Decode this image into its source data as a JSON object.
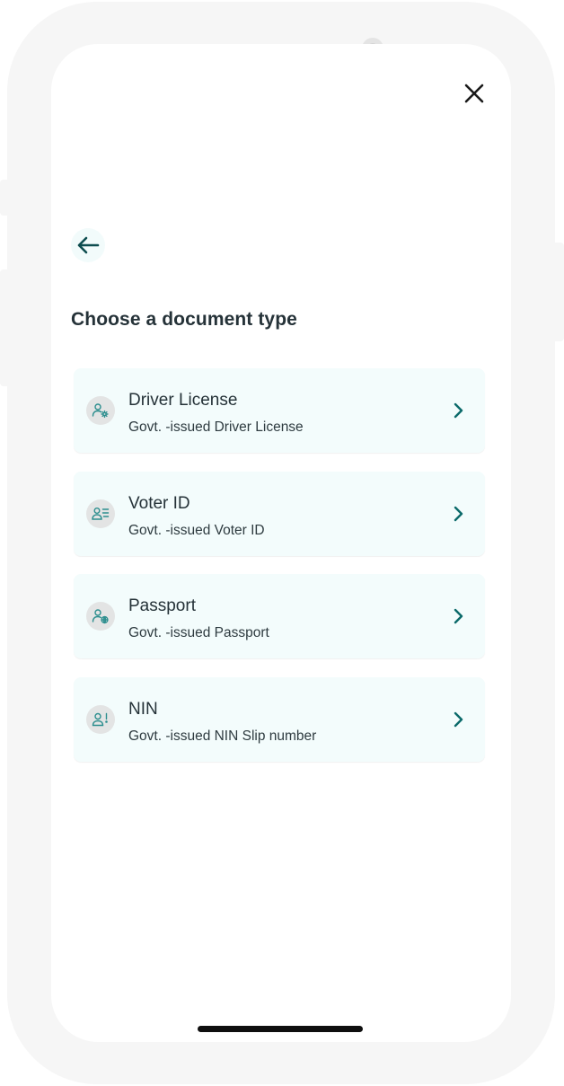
{
  "page": {
    "title": "Choose a document type"
  },
  "icons": {
    "close": "close-icon",
    "back": "arrow-left-icon",
    "chevron": "chevron-right-icon"
  },
  "colors": {
    "accent": "#0b6a6a",
    "title_text": "#253238",
    "card_background": "#f3fcfc",
    "icon_background": "#e3e4e4"
  },
  "documents": [
    {
      "name": "Driver License",
      "subtitle": "Govt. -issued Driver License",
      "icon": "user-gear-icon"
    },
    {
      "name": "Voter ID",
      "subtitle": "Govt. -issued Voter ID",
      "icon": "user-list-icon"
    },
    {
      "name": "Passport",
      "subtitle": "Govt. -issued Passport",
      "icon": "user-globe-icon"
    },
    {
      "name": "NIN",
      "subtitle": "Govt. -issued NIN Slip number",
      "icon": "user-alert-icon"
    }
  ]
}
